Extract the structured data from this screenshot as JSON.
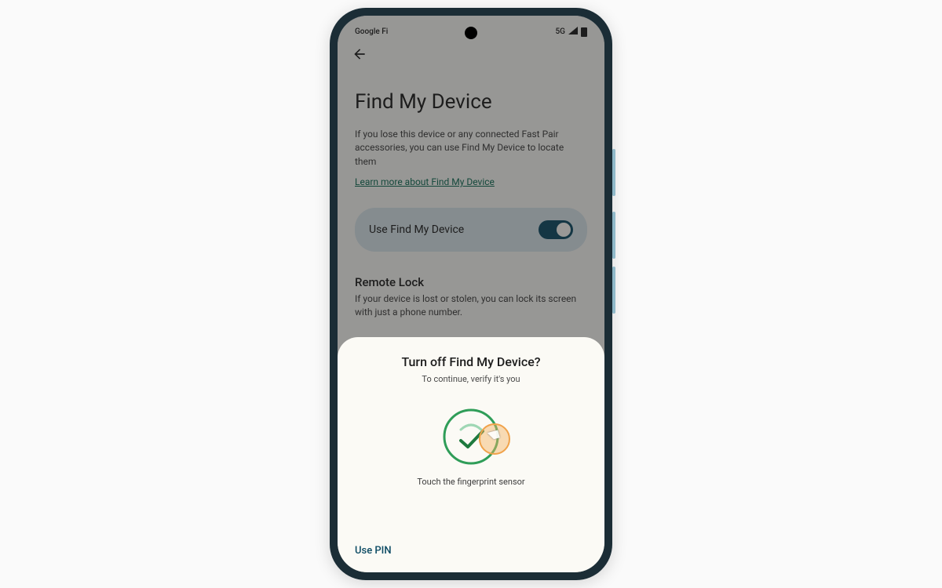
{
  "status_bar": {
    "carrier": "Google Fi",
    "network": "5G"
  },
  "page": {
    "title": "Find My Device",
    "description": "If you lose this device or any connected Fast Pair accessories, you can use Find My Device to locate them",
    "learn_more": "Learn more about Find My Device",
    "toggle": {
      "label": "Use Find My Device",
      "on": true
    },
    "remote_lock": {
      "title": "Remote Lock",
      "description": "If your device is lost or stolen, you can lock its screen with just a phone number."
    }
  },
  "sheet": {
    "title": "Turn off Find My Device?",
    "subtitle": "To continue, verify it's you",
    "instruction": "Touch the fingerprint sensor",
    "alt_action": "Use PIN"
  }
}
